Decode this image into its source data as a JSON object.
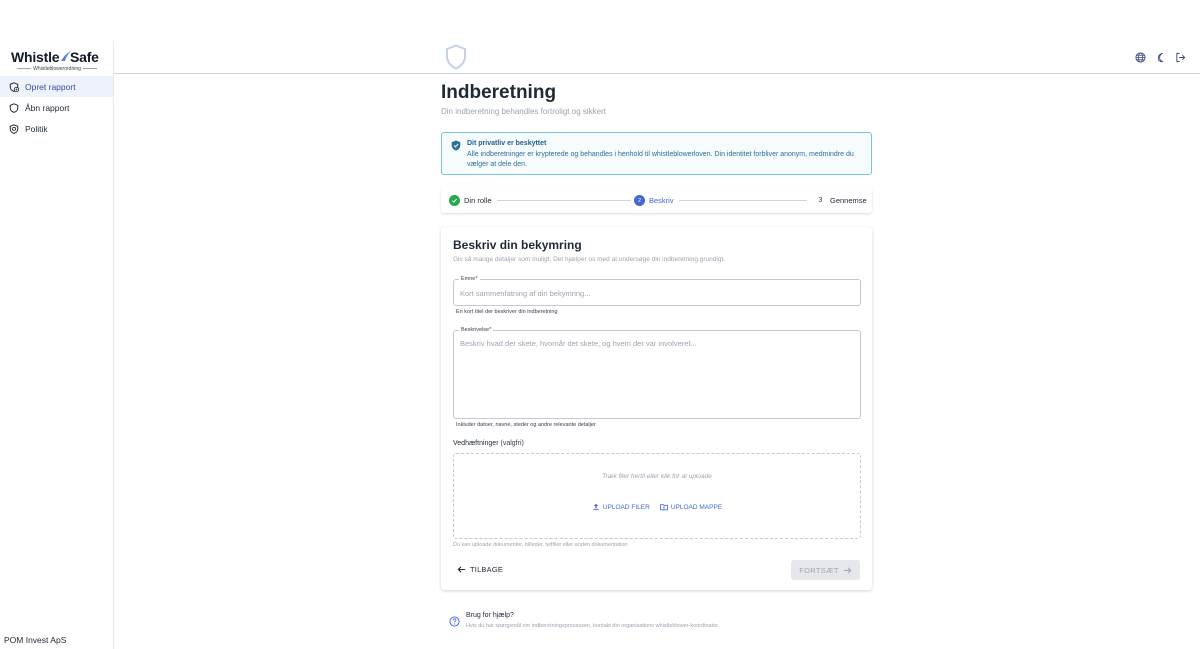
{
  "brand": {
    "name_left": "Whistle",
    "name_right": "Safe",
    "tagline": "Whistleblowerordning"
  },
  "sidebar": {
    "items": [
      {
        "label": "Opret rapport",
        "icon": "shield-plus-icon",
        "active": true
      },
      {
        "label": "Åbn rapport",
        "icon": "shield-icon",
        "active": false
      },
      {
        "label": "Politik",
        "icon": "shield-badge-icon",
        "active": false
      }
    ],
    "company": "POM Invest ApS"
  },
  "topbar": {
    "icons": [
      "globe-icon",
      "moon-icon",
      "logout-icon"
    ]
  },
  "page": {
    "title": "Indberetning",
    "subtitle": "Din indberetning behandles fortroligt og sikkert"
  },
  "privacy": {
    "title": "Dit privatliv er beskyttet",
    "text": "Alle indberetninger er krypterede og behandles i henhold til whistleblowerloven. Din identitet forbliver anonym, medmindre du vælger at dele den."
  },
  "stepper": {
    "steps": [
      {
        "label": "Din rolle",
        "state": "done"
      },
      {
        "number": "2",
        "label": "Beskriv",
        "state": "active"
      },
      {
        "number": "3",
        "label": "Gennemse",
        "state": "pending"
      }
    ]
  },
  "form": {
    "title": "Beskriv din bekymring",
    "subtitle": "Giv så mange detaljer som muligt. Det hjælper os med at undersøge din indberetning grundigt.",
    "subject": {
      "label": "Emne*",
      "value": "",
      "placeholder": "Kort sammenfatning af din bekymring...",
      "helper": "En kort titel der beskriver din indberetning"
    },
    "description": {
      "label": "Beskrivelse*",
      "value": "",
      "placeholder": "Beskriv hvad der skete, hvornår det skete, og hvem der var involveret...",
      "helper": "Inkluder datoer, navne, steder og andre relevante detaljer"
    },
    "attachments": {
      "label": "Vedhæftninger",
      "optional": "(valgfri)",
      "drop_hint": "Træk filer hertil eller klik for at uploade",
      "upload_files": "UPLOAD FILER",
      "upload_folder": "UPLOAD MAPPE",
      "helper": "Du kan uploade dokumenter, billeder, lydfiler eller anden dokumentation"
    },
    "back_label": "TILBAGE",
    "next_label": "FORTSÆT"
  },
  "help": {
    "title": "Brug for hjælp?",
    "text": "Hvis du har spørgsmål om indberetningsprocessen, kontakt din organisations whistleblower-koordinator."
  },
  "colors": {
    "accent": "#4466d6",
    "success": "#22a94b",
    "info_border": "#7cc5d8",
    "active_nav_bg": "#eef2fb"
  }
}
